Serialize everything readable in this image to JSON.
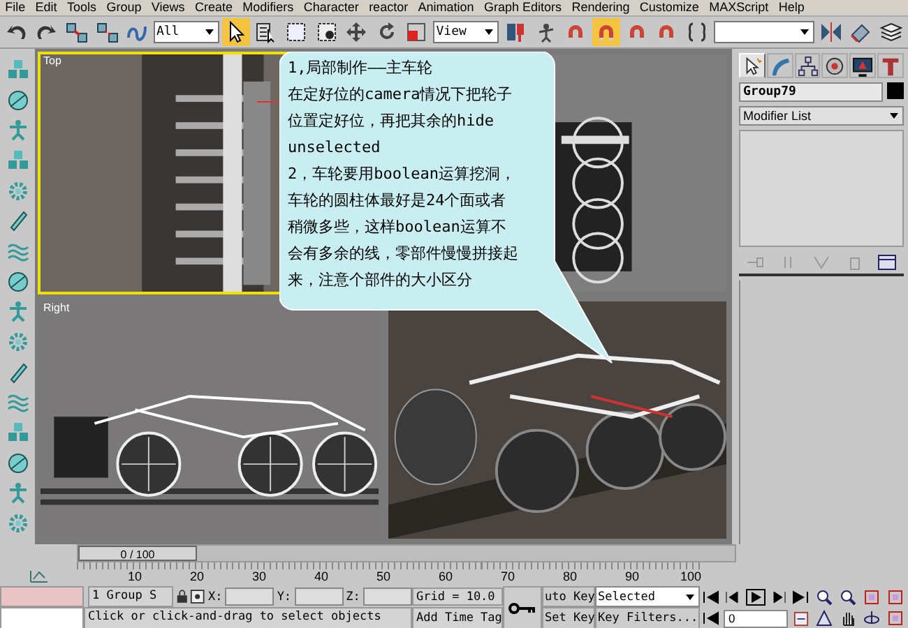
{
  "menu_bar": [
    "File",
    "Edit",
    "Tools",
    "Group",
    "Views",
    "Create",
    "Modifiers",
    "Character",
    "reactor",
    "Animation",
    "Graph Editors",
    "Rendering",
    "Customize",
    "MAXScript",
    "Help"
  ],
  "toolbar": [
    {
      "kind": "undo",
      "selected": false
    },
    {
      "kind": "redo",
      "selected": false
    },
    {
      "kind": "link",
      "selected": false
    },
    {
      "kind": "unlink",
      "selected": false
    },
    {
      "kind": "bind",
      "selected": false
    },
    {
      "kind": "dropdown",
      "value": "All"
    },
    {
      "kind": "select",
      "selected": true
    },
    {
      "kind": "select-name",
      "selected": false
    },
    {
      "kind": "region",
      "selected": false
    },
    {
      "kind": "window",
      "selected": false
    },
    {
      "kind": "move",
      "selected": false
    },
    {
      "kind": "rotate",
      "selected": false
    },
    {
      "kind": "scale",
      "selected": false
    },
    {
      "kind": "dropdown",
      "value": "View"
    },
    {
      "kind": "pivot",
      "selected": false
    },
    {
      "kind": "manipulate",
      "selected": false
    },
    {
      "kind": "snap",
      "selected": false
    },
    {
      "kind": "angle-snap",
      "selected": true
    },
    {
      "kind": "percent-snap",
      "selected": false
    },
    {
      "kind": "spinner-snap",
      "selected": false
    },
    {
      "kind": "named-selection",
      "selected": false
    },
    {
      "kind": "dropdown"
    },
    {
      "kind": "mirror",
      "selected": false
    },
    {
      "kind": "align",
      "selected": false
    },
    {
      "kind": "layers",
      "selected": false
    }
  ],
  "viewports": [
    {
      "kind": "plan",
      "label": "Top",
      "active": true
    },
    {
      "kind": "end",
      "active": false
    },
    {
      "kind": "side",
      "label": "Right",
      "active": false
    },
    {
      "kind": "shaded",
      "active": false
    }
  ],
  "callout": {
    "paragraphs": [
      "1,局部制作——主车轮",
      "在定好位的camera情况下把轮子位置定好位，再把其余的hide unselected",
      "2，车轮要用boolean运算挖洞，车轮的圆柱体最好是24个面或者稍微多些，这样boolean运算不会有多余的线，零部件慢慢拼接起来，注意个部件的大小区分"
    ]
  },
  "command_panel": {
    "tabs": [
      {
        "kind": "create",
        "selected": true
      },
      {
        "kind": "modify",
        "selected": false
      },
      {
        "kind": "hierarchy",
        "selected": false
      },
      {
        "kind": "motion",
        "selected": false
      },
      {
        "kind": "display",
        "selected": false
      },
      {
        "kind": "utilities",
        "selected": false
      }
    ],
    "object_name": "Group79",
    "modifier_list": "Modifier List"
  },
  "time_slider": "0 / 100",
  "ruler_labels": [
    "10",
    "20",
    "30",
    "40",
    "50",
    "60",
    "70",
    "80",
    "90",
    "100"
  ],
  "status": {
    "selection_info": "1 Group S",
    "coords": [
      "X:",
      "Y:",
      "Z:"
    ],
    "grid": "Grid = 10.0",
    "auto_key": "uto Key",
    "set_key": "Set Key",
    "key_mode": "Selected",
    "key_filters": "Key Filters...",
    "frame": "0",
    "prompt": "Click or click-and-drag to select objects",
    "time_tag": "Add Time Tag"
  }
}
